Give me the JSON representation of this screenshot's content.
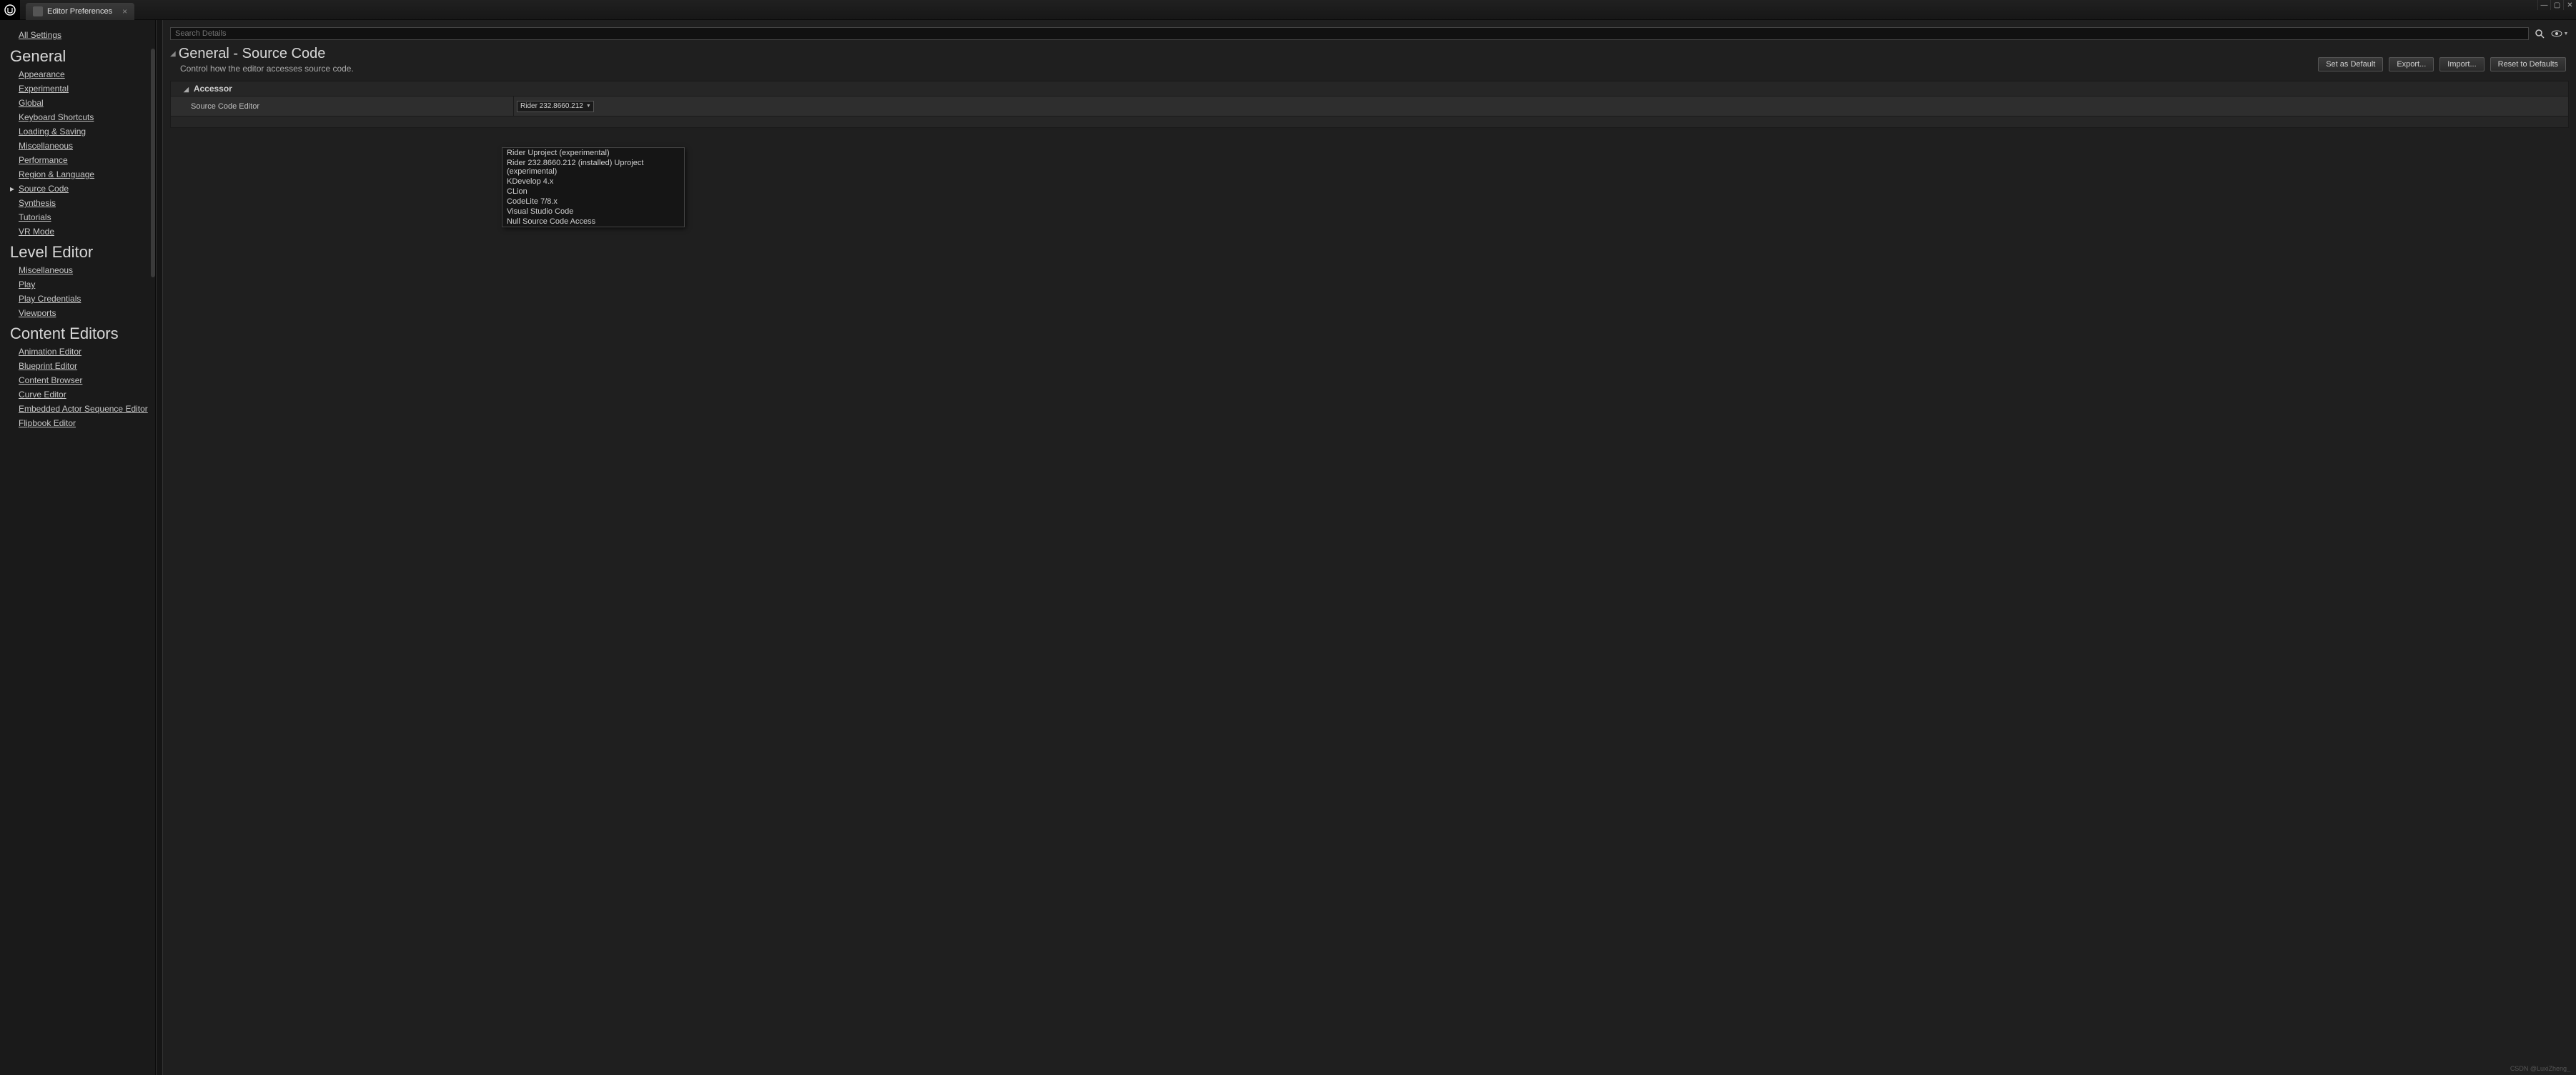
{
  "window": {
    "tab_title": "Editor Preferences"
  },
  "sidebar": {
    "all_settings": "All Settings",
    "categories": [
      {
        "header": "General",
        "items": [
          {
            "label": "Appearance",
            "selected": false
          },
          {
            "label": "Experimental",
            "selected": false
          },
          {
            "label": "Global",
            "selected": false
          },
          {
            "label": "Keyboard Shortcuts",
            "selected": false
          },
          {
            "label": "Loading & Saving",
            "selected": false
          },
          {
            "label": "Miscellaneous",
            "selected": false
          },
          {
            "label": "Performance",
            "selected": false
          },
          {
            "label": "Region & Language",
            "selected": false
          },
          {
            "label": "Source Code",
            "selected": true
          },
          {
            "label": "Synthesis",
            "selected": false
          },
          {
            "label": "Tutorials",
            "selected": false
          },
          {
            "label": "VR Mode",
            "selected": false
          }
        ]
      },
      {
        "header": "Level Editor",
        "items": [
          {
            "label": "Miscellaneous",
            "selected": false
          },
          {
            "label": "Play",
            "selected": false
          },
          {
            "label": "Play Credentials",
            "selected": false
          },
          {
            "label": "Viewports",
            "selected": false
          }
        ]
      },
      {
        "header": "Content Editors",
        "items": [
          {
            "label": "Animation Editor",
            "selected": false
          },
          {
            "label": "Blueprint Editor",
            "selected": false
          },
          {
            "label": "Content Browser",
            "selected": false
          },
          {
            "label": "Curve Editor",
            "selected": false
          },
          {
            "label": "Embedded Actor Sequence Editor",
            "selected": false
          },
          {
            "label": "Flipbook Editor",
            "selected": false
          }
        ]
      }
    ]
  },
  "content": {
    "search_placeholder": "Search Details",
    "title": "General - Source Code",
    "description": "Control how the editor accesses source code.",
    "buttons": {
      "default": "Set as Default",
      "export": "Export...",
      "import": "Import...",
      "reset": "Reset to Defaults"
    },
    "section": {
      "header": "Accessor",
      "property_label": "Source Code Editor",
      "selected_value": "Rider 232.8660.212",
      "options": [
        "Rider Uproject (experimental)",
        "Rider 232.8660.212 (installed) Uproject (experimental)",
        "KDevelop 4.x",
        "CLion",
        "CodeLite 7/8.x",
        "Visual Studio Code",
        "Null Source Code Access"
      ]
    }
  },
  "watermark": "CSDN @LuxiZheng_"
}
